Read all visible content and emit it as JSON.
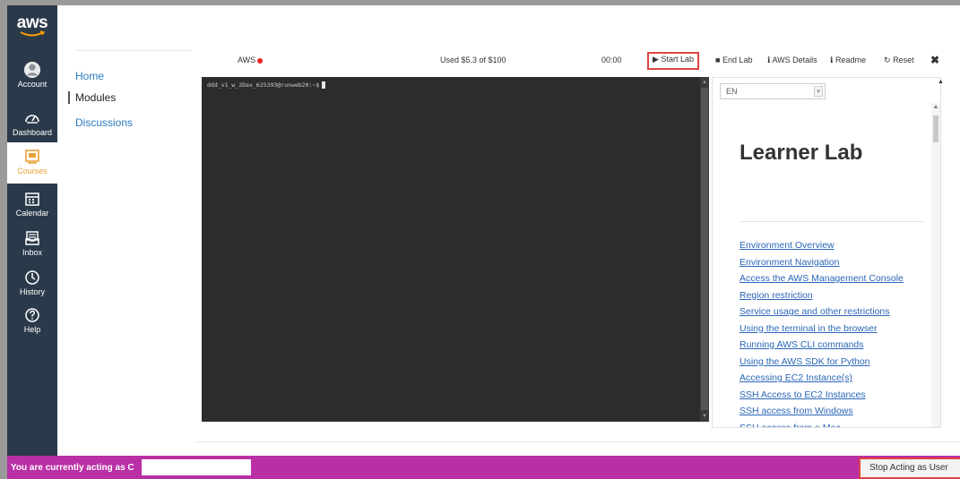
{
  "global_nav": {
    "logo_text": "aws",
    "items": [
      {
        "label": "Account",
        "icon": "account-icon"
      },
      {
        "label": "Dashboard",
        "icon": "dashboard-icon"
      },
      {
        "label": "Courses",
        "icon": "courses-icon"
      },
      {
        "label": "Calendar",
        "icon": "calendar-icon"
      },
      {
        "label": "Inbox",
        "icon": "inbox-icon"
      },
      {
        "label": "History",
        "icon": "history-icon"
      },
      {
        "label": "Help",
        "icon": "help-icon"
      }
    ]
  },
  "course_nav": {
    "items": [
      {
        "label": "Home"
      },
      {
        "label": "Modules"
      },
      {
        "label": "Discussions"
      }
    ]
  },
  "toolbar": {
    "aws_label": "AWS",
    "budget": "Used $5.3 of $100",
    "timer": "00:00",
    "start_lab": "Start Lab",
    "end_lab": "End Lab",
    "aws_details": "AWS Details",
    "readme": "Readme",
    "reset": "Reset"
  },
  "terminal": {
    "prompt": "ddd_v1_w_2Dax_625393@runweb20:~$"
  },
  "readme": {
    "language": "EN",
    "title": "Learner Lab",
    "links": [
      "Environment Overview",
      "Environment Navigation",
      "Access the AWS Management Console",
      "Region restriction",
      "Service usage and other restrictions",
      "Using the terminal in the browser",
      "Running AWS CLI commands",
      "Using the AWS SDK for Python",
      "Accessing EC2 Instance(s)",
      "SSH Access to EC2 Instances",
      "SSH access from Windows",
      "SSH access from a Mac"
    ]
  },
  "masquerade": {
    "text": "You are currently acting as C",
    "stop_button": "Stop Acting as User"
  },
  "colors": {
    "nav_bg": "#2b3a4a",
    "masquerade_bg": "#b82fa6",
    "link": "#2a66b8",
    "highlight": "#dd4444"
  }
}
